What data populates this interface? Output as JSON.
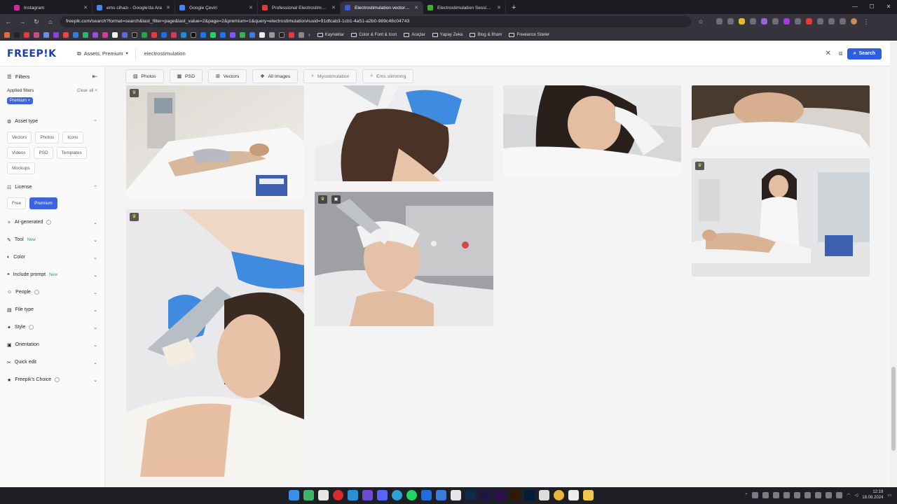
{
  "browser": {
    "tabs": [
      {
        "title": "Instagram",
        "color": "#d6249f"
      },
      {
        "title": "ems cihazı - Google'da Ara",
        "color": "#4285f4"
      },
      {
        "title": "Google Çeviri",
        "color": "#4285f4"
      },
      {
        "title": "Professional Electrostimulation",
        "color": "#e53935"
      },
      {
        "title": "Electrostimulation vectors, phot",
        "color": "#3b5bdb",
        "active": true
      },
      {
        "title": "Electrostimulation Session Pict",
        "color": "#43b02a"
      }
    ],
    "url": "freepik.com/search?format=search&last_filter=page&last_value=2&page=2&premium=1&query=electrostimulation#uuid=91dfcab3-1cb1-4a51-a2b0-989c48c04743",
    "bookmark_folders": [
      "Kaynaklar",
      "Color & Font & Icon",
      "Araçlar",
      "Yapay Zeka",
      "Blog & İlham",
      "Freelance Siteler"
    ]
  },
  "header": {
    "logo": "FREEP!K",
    "asset_selector": "Assets, Premium",
    "search_value": "electrostimulation",
    "search_button": "Search"
  },
  "sidebar": {
    "title": "Filters",
    "applied_label": "Applied filters",
    "clear_all": "Clear all",
    "applied_chip": "Premium ×",
    "asset_type": {
      "label": "Asset type",
      "options": [
        "Vectors",
        "Photos",
        "Icons",
        "Videos",
        "PSD",
        "Templates",
        "Mockups"
      ]
    },
    "license": {
      "label": "License",
      "options": [
        "Free",
        "Premium"
      ]
    },
    "sections": [
      {
        "label": "AI-generated",
        "info": true
      },
      {
        "label": "Tool",
        "badge": "New"
      },
      {
        "label": "Color"
      },
      {
        "label": "Include prompt",
        "badge": "New"
      },
      {
        "label": "People",
        "info": true
      },
      {
        "label": "File type"
      },
      {
        "label": "Style",
        "info": true
      },
      {
        "label": "Orientation"
      },
      {
        "label": "Quick edit"
      },
      {
        "label": "Freepik's Choice",
        "info": true
      }
    ]
  },
  "filterbar": {
    "chips": [
      "Photos",
      "PSD",
      "Vectors",
      "All Images"
    ],
    "suggestions": [
      "Myostimulation",
      "Ems slimming"
    ]
  },
  "taskbar": {
    "time": "12:19",
    "date": "18.08.2024"
  },
  "colors": {
    "accent": "#2f5fe0",
    "brand": "#1b3fa6"
  }
}
